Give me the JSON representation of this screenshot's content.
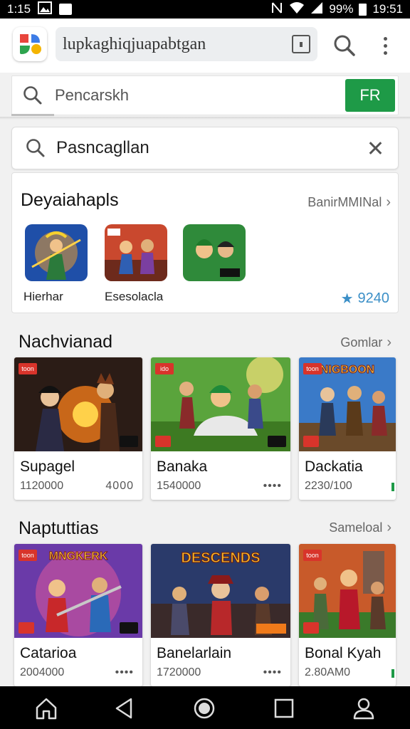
{
  "status_bar": {
    "left_time": "1:15",
    "battery_pct": "99%",
    "time": "19:51"
  },
  "top_bar": {
    "url": "lupkaghiqjuapabtgan"
  },
  "search_bar": {
    "placeholder": "Pencarskh",
    "button_label": "FR"
  },
  "main_search": {
    "query": "Pasncagllan"
  },
  "featured": {
    "title": "Deyaiahapls",
    "link": "BanirMMINal",
    "apps": [
      {
        "label": "Hierhar"
      },
      {
        "label": "Esesolacla"
      },
      {
        "label": ""
      }
    ],
    "rating": "9240"
  },
  "sections": [
    {
      "title": "Nachvianad",
      "link": "Gomlar",
      "items": [
        {
          "name": "Supagel",
          "meta": "1120000",
          "extra": "4000",
          "badge": "toon",
          "art_title": ""
        },
        {
          "name": "Banaka",
          "meta": "1540000",
          "extra": "••••",
          "badge": "ido",
          "art_title": ""
        },
        {
          "name": "Dackatia",
          "meta": "2230/100",
          "extra": "",
          "badge": "toon",
          "art_title": "NIGBOON"
        }
      ]
    },
    {
      "title": "Naptuttias",
      "link": "Sameloal",
      "items": [
        {
          "name": "Catarioa",
          "meta": "2004000",
          "extra": "••••",
          "badge": "toon",
          "art_title": "MNGKERK"
        },
        {
          "name": "Banelarlain",
          "meta": "1720000",
          "extra": "••••",
          "badge": "",
          "art_title": "DESCENDS"
        },
        {
          "name": "Bonal Kyah",
          "meta": "2.80AM0",
          "extra": "",
          "badge": "toon",
          "art_title": ""
        }
      ]
    }
  ],
  "colors": {
    "accent_green": "#1e9a47",
    "rating_blue": "#3b8fc7",
    "badge_red": "#d8342b"
  },
  "nav_bar": {
    "icons": [
      "home-icon",
      "back-icon",
      "circle-home-icon",
      "recents-icon",
      "account-icon"
    ]
  }
}
